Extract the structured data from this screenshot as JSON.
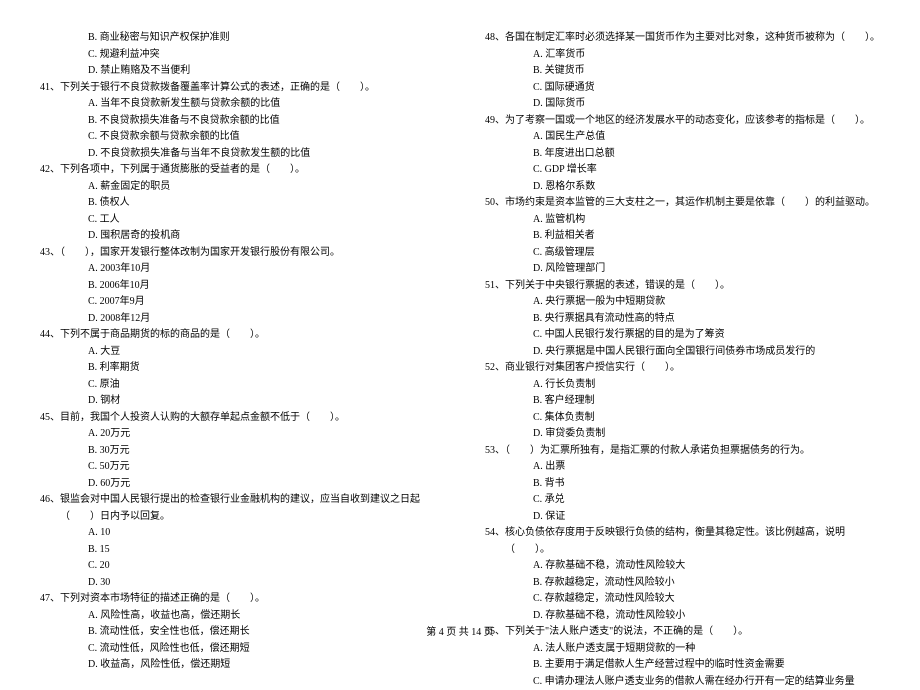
{
  "left": {
    "opt_b_40": "B. 商业秘密与知识产权保护准则",
    "opt_c_40": "C. 规避利益冲突",
    "opt_d_40": "D. 禁止贿赂及不当便利",
    "q41": "41、下列关于银行不良贷款拨备覆盖率计算公式的表述，正确的是（　　）。",
    "q41_a": "A. 当年不良贷款新发生额与贷款余额的比值",
    "q41_b": "B. 不良贷款损失准备与不良贷款余额的比值",
    "q41_c": "C. 不良贷款余额与贷款余额的比值",
    "q41_d": "D. 不良贷款损失准备与当年不良贷款发生额的比值",
    "q42": "42、下列各项中，下列属于通货膨胀的受益者的是（　　）。",
    "q42_a": "A. 薪金固定的职员",
    "q42_b": "B. 债权人",
    "q42_c": "C. 工人",
    "q42_d": "D. 囤积居奇的投机商",
    "q43": "43、（　　），国家开发银行整体改制为国家开发银行股份有限公司。",
    "q43_a": "A. 2003年10月",
    "q43_b": "B. 2006年10月",
    "q43_c": "C. 2007年9月",
    "q43_d": "D. 2008年12月",
    "q44": "44、下列不属于商品期货的标的商品的是（　　）。",
    "q44_a": "A. 大豆",
    "q44_b": "B. 利率期货",
    "q44_c": "C. 原油",
    "q44_d": "D. 钢材",
    "q45": "45、目前，我国个人投资人认购的大额存单起点金额不低于（　　）。",
    "q45_a": "A. 20万元",
    "q45_b": "B. 30万元",
    "q45_c": "C. 50万元",
    "q45_d": "D. 60万元",
    "q46": "46、银监会对中国人民银行提出的检查银行业金融机构的建议，应当自收到建议之日起（　　）日内予以回复。",
    "q46_a": "A. 10",
    "q46_b": "B. 15",
    "q46_c": "C. 20",
    "q46_d": "D. 30",
    "q47": "47、下列对资本市场特征的描述正确的是（　　）。",
    "q47_a": "A. 风险性高，收益也高，偿还期长",
    "q47_b": "B. 流动性低，安全性也低，偿还期长",
    "q47_c": "C. 流动性低，风险性也低，偿还期短",
    "q47_d": "D. 收益高，风险性低，偿还期短"
  },
  "right": {
    "q48": "48、各国在制定汇率时必须选择某一国货币作为主要对比对象，这种货币被称为（　　）。",
    "q48_a": "A. 汇率货币",
    "q48_b": "B. 关键货币",
    "q48_c": "C. 国际硬通货",
    "q48_d": "D. 国际货币",
    "q49": "49、为了考察一国或一个地区的经济发展水平的动态变化，应该参考的指标是（　　）。",
    "q49_a": "A. 国民生产总值",
    "q49_b": "B. 年度进出口总额",
    "q49_c": "C. GDP 增长率",
    "q49_d": "D. 恩格尔系数",
    "q50": "50、市场约束是资本监管的三大支柱之一，其运作机制主要是依靠（　　）的利益驱动。",
    "q50_a": "A. 监管机构",
    "q50_b": "B. 利益相关者",
    "q50_c": "C. 高级管理层",
    "q50_d": "D. 风险管理部门",
    "q51": "51、下列关于中央银行票据的表述，错误的是（　　）。",
    "q51_a": "A. 央行票据一般为中短期贷款",
    "q51_b": "B. 央行票据具有流动性高的特点",
    "q51_c": "C. 中国人民银行发行票据的目的是为了筹资",
    "q51_d": "D. 央行票据是中国人民银行面向全国银行间债券市场成员发行的",
    "q52": "52、商业银行对集团客户授信实行（　　）。",
    "q52_a": "A. 行长负责制",
    "q52_b": "B. 客户经理制",
    "q52_c": "C. 集体负责制",
    "q52_d": "D. 审贷委负责制",
    "q53": "53、（　　）为汇票所独有，是指汇票的付款人承诺负担票据债务的行为。",
    "q53_a": "A. 出票",
    "q53_b": "B. 背书",
    "q53_c": "C. 承兑",
    "q53_d": "D. 保证",
    "q54": "54、核心负债依存度用于反映银行负债的结构，衡量其稳定性。该比例越高，说明（　　）。",
    "q54_a": "A. 存款基础不稳，流动性风险较大",
    "q54_b": "B. 存款越稳定，流动性风险较小",
    "q54_c": "C. 存款越稳定，流动性风险较大",
    "q54_d": "D. 存款基础不稳，流动性风险较小",
    "q55": "55、下列关于\"法人账户透支\"的说法，不正确的是（　　）。",
    "q55_a": "A. 法人账户透支属于短期贷款的一种",
    "q55_b": "B. 主要用于满足借款人生产经营过程中的临时性资金需要",
    "q55_c": "C. 申请办理法人账户透支业务的借款人需在经办行开有一定的结算业务量"
  },
  "footer": "第 4 页 共 14 页"
}
